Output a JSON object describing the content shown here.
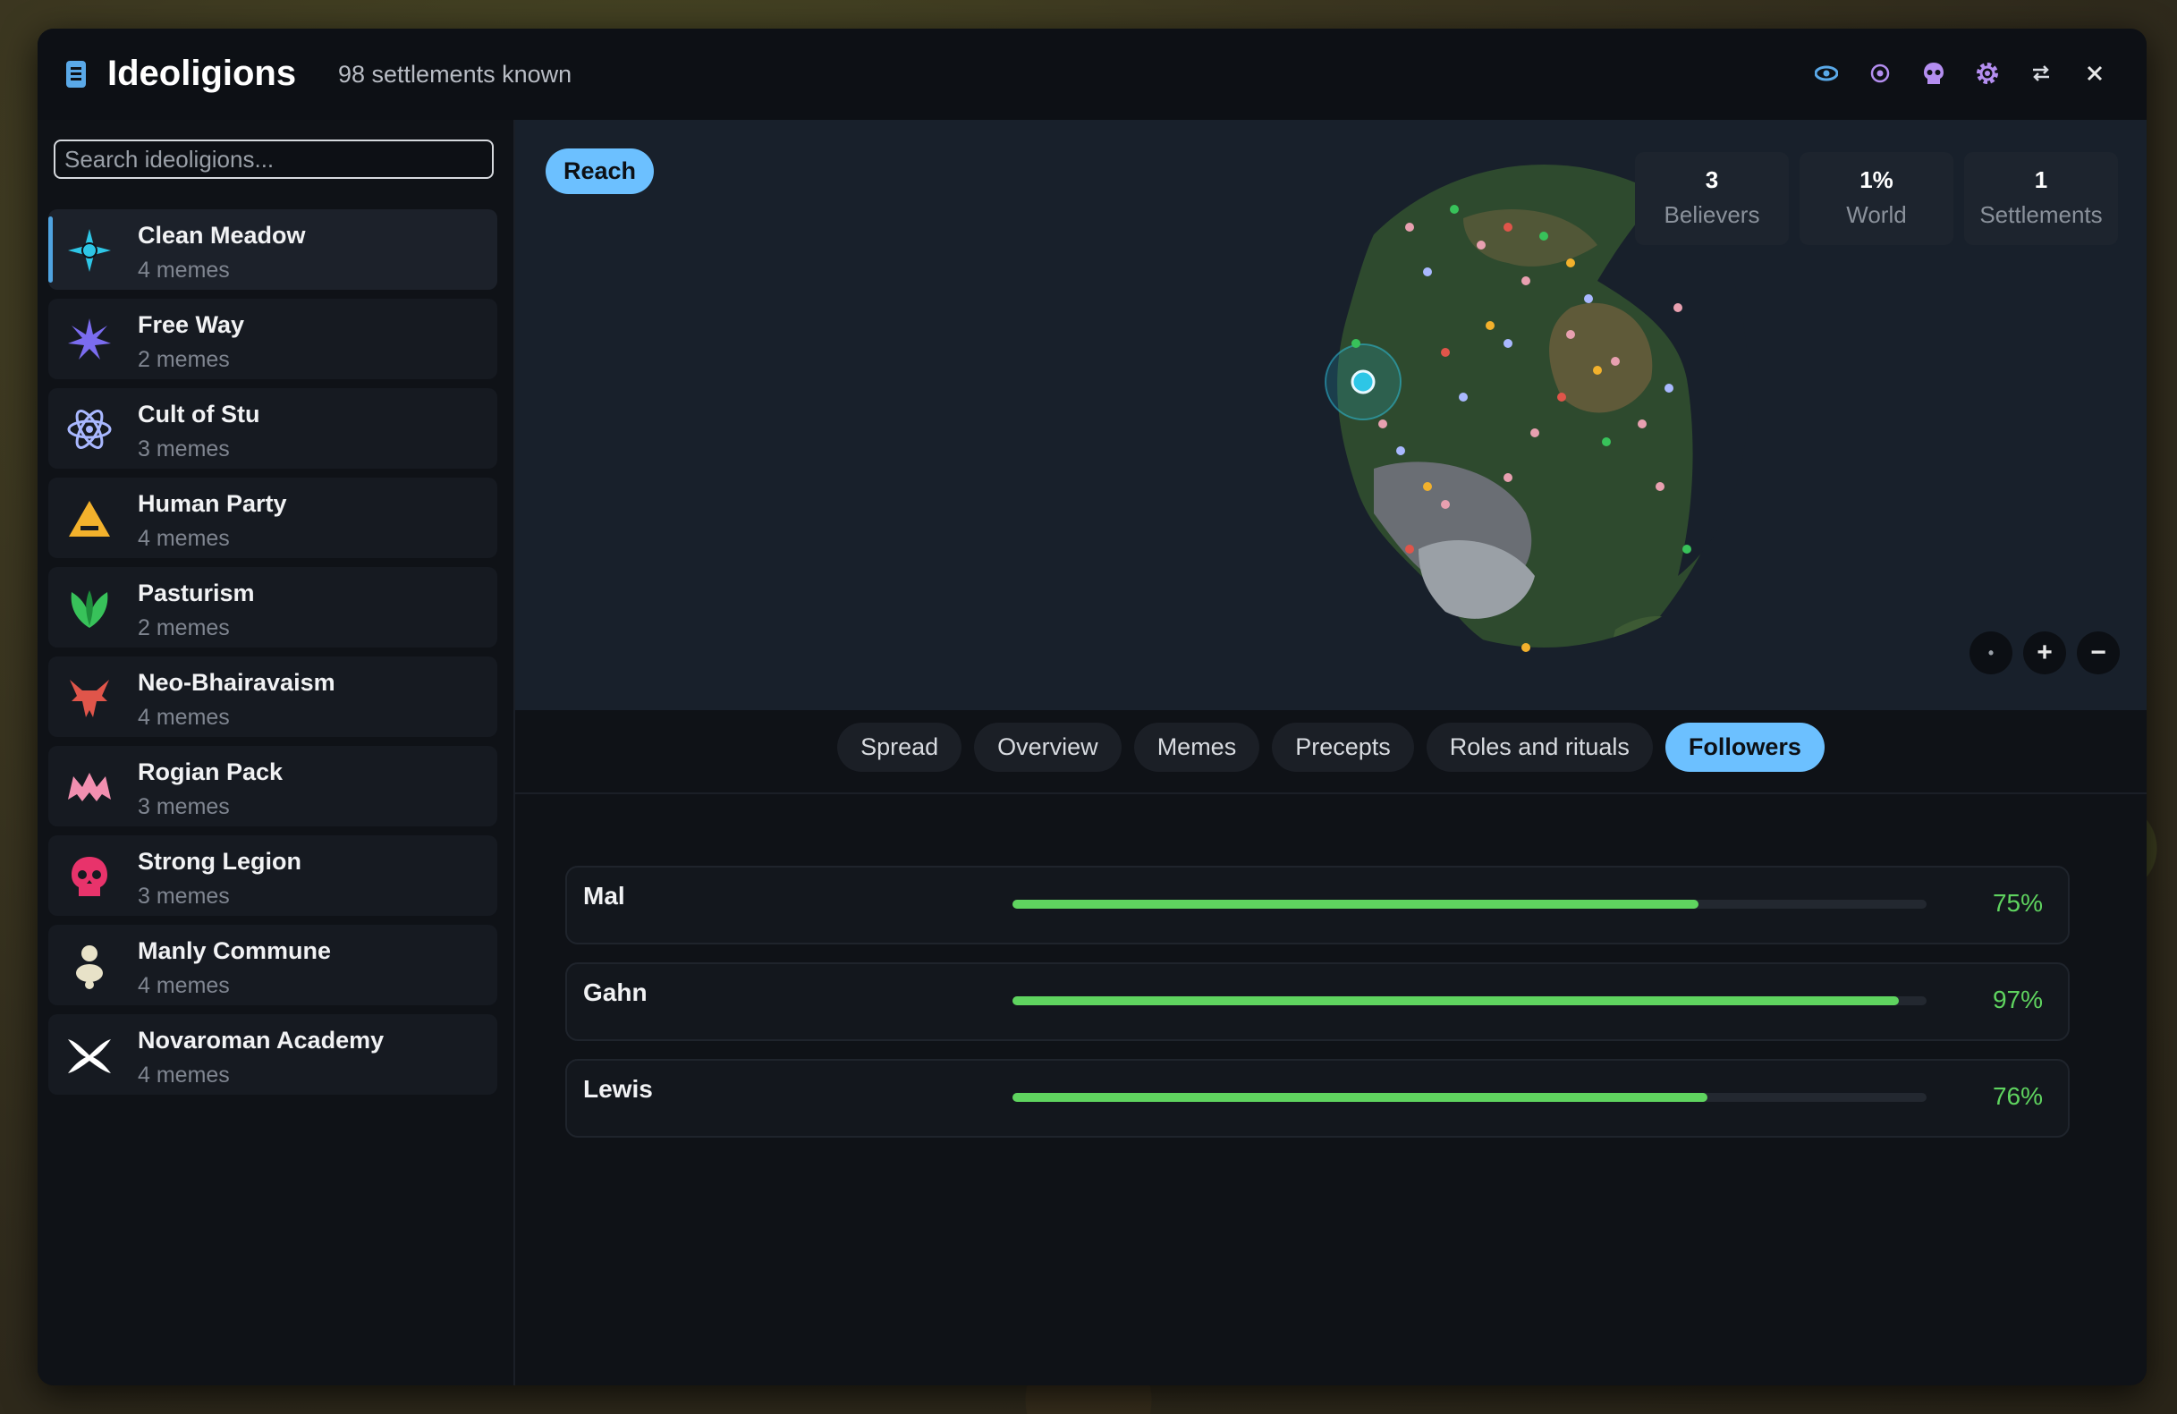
{
  "window": {
    "title": "Ideoligions",
    "subtitle": "98 settlements known",
    "toolbar_icons": [
      "eye-icon",
      "target-icon",
      "skull-icon",
      "gear-icon",
      "swap-icon",
      "close-icon"
    ]
  },
  "sidebar": {
    "search_placeholder": "Search ideoligions...",
    "items": [
      {
        "name": "Clean Meadow",
        "sub": "4 memes",
        "icon": "cross-diamond-icon",
        "color": "#2ec6e6",
        "active": true
      },
      {
        "name": "Free Way",
        "sub": "2 memes",
        "icon": "starburst-icon",
        "color": "#7b6cf0"
      },
      {
        "name": "Cult of Stu",
        "sub": "3 memes",
        "icon": "atom-icon",
        "color": "#a9b8ff"
      },
      {
        "name": "Human Party",
        "sub": "4 memes",
        "icon": "triangle-icon",
        "color": "#f2b12c"
      },
      {
        "name": "Pasturism",
        "sub": "2 memes",
        "icon": "leaf-icon",
        "color": "#38c25a"
      },
      {
        "name": "Neo-Bhairavaism",
        "sub": "4 memes",
        "icon": "demon-icon",
        "color": "#e0554a"
      },
      {
        "name": "Rogian Pack",
        "sub": "3 memes",
        "icon": "wolf-icon",
        "color": "#f28fb0"
      },
      {
        "name": "Strong Legion",
        "sub": "3 memes",
        "icon": "skull-icon",
        "color": "#e8336b"
      },
      {
        "name": "Manly Commune",
        "sub": "4 memes",
        "icon": "figure-icon",
        "color": "#e8e2c8"
      },
      {
        "name": "Novaroman Academy",
        "sub": "4 memes",
        "icon": "horns-icon",
        "color": "#ffffff"
      }
    ]
  },
  "map": {
    "reach_label": "Reach",
    "stats": [
      {
        "value": "3",
        "label": "Believers"
      },
      {
        "value": "1%",
        "label": "World"
      },
      {
        "value": "1",
        "label": "Settlements"
      }
    ],
    "controls": [
      {
        "name": "recenter-icon",
        "glyph": "•"
      },
      {
        "name": "zoom-in-icon",
        "glyph": "+"
      },
      {
        "name": "zoom-out-icon",
        "glyph": "−"
      }
    ]
  },
  "tabs": [
    {
      "label": "Spread"
    },
    {
      "label": "Overview"
    },
    {
      "label": "Memes"
    },
    {
      "label": "Precepts"
    },
    {
      "label": "Roles and rituals"
    },
    {
      "label": "Followers",
      "active": true
    }
  ],
  "followers": [
    {
      "name": "Mal",
      "percent_label": "75%",
      "fraction": 0.75
    },
    {
      "name": "Gahn",
      "percent_label": "97%",
      "fraction": 0.97
    },
    {
      "name": "Lewis",
      "percent_label": "76%",
      "fraction": 0.76
    }
  ]
}
